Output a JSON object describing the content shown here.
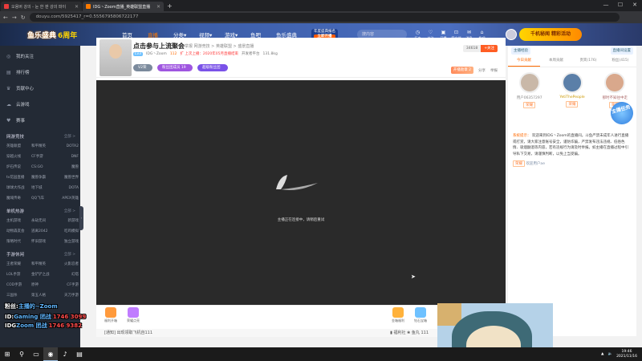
{
  "browser": {
    "tabs": [
      {
        "label": "오용버 강의 - 눈 한 판 강의 파이",
        "color": "#e83b3b",
        "active": false
      },
      {
        "label": "IDG丶Zoom直播_英雄联盟直播",
        "color": "#ff7a00",
        "active": true
      }
    ],
    "new_tab": "+",
    "url": "douyu.com/5925417_r=0.5556795806722177",
    "win_min": "—",
    "win_max": "☐",
    "win_close": "✕"
  },
  "nav": {
    "logo_text": "鱼乐盛典",
    "logo_year": "6周年",
    "links": [
      {
        "label": "首页",
        "active": false
      },
      {
        "label": "直播",
        "active": true
      },
      {
        "label": "分类▾",
        "active": false
      },
      {
        "label": "视频▾",
        "active": false
      },
      {
        "label": "游戏▾",
        "active": false
      },
      {
        "label": "鱼吧",
        "active": false
      },
      {
        "label": "鱼乐盛典",
        "active": false
      }
    ],
    "promo_top": "年度盛典报名",
    "promo_btn": "立即开播",
    "search_placeholder": "搜内容",
    "icons": [
      {
        "glyph": "◷",
        "label": "历史"
      },
      {
        "glyph": "♡",
        "label": "关注"
      },
      {
        "glyph": "▣",
        "label": "开播"
      },
      {
        "glyph": "⊡",
        "label": "客户端"
      },
      {
        "glyph": "✉",
        "label": "消息"
      },
      {
        "glyph": "⌂",
        "label": "鱼吧"
      }
    ],
    "banner_text": "千机秘闻 精彩活动"
  },
  "sidebar": {
    "main": [
      {
        "icon": "◎",
        "label": "我的关注"
      },
      {
        "icon": "▤",
        "label": "排行榜"
      },
      {
        "icon": "♛",
        "label": "贡献中心"
      },
      {
        "icon": "☁",
        "label": "云游戏"
      },
      {
        "icon": "♥",
        "label": "赛事"
      }
    ],
    "sections": [
      {
        "title": "网游竞技",
        "all": "全部 >",
        "items": [
          "英雄联盟",
          "和平精英",
          "DOTA2",
          "穿越火线",
          "CF手游",
          "DNF",
          "炉石传说",
          "CS:GO",
          "魔兽",
          "tv花园直播",
          "魔兽争霸",
          "魔兽世界",
          "球球大作战",
          "地下城",
          "DOTA",
          "魔域传奇",
          "QQ飞车",
          "APEX英雄"
        ]
      },
      {
        "title": "单机热游",
        "all": "全部 >",
        "items": [
          "主机游戏",
          "永劫无间",
          "新游戏",
          "动物森友会",
          "逃离2042",
          "吃鸡模拟",
          "策略时代",
          "怀旧游戏",
          "独立游戏"
        ]
      },
      {
        "title": "手游休闲",
        "all": "全部 >",
        "items": [
          "王者荣耀",
          "和平精英",
          "火影忍者",
          "LOL手游",
          "金铲铲之战",
          "幻塔",
          "COD手游",
          "原神",
          "CF手游",
          "三国杀",
          "第五人格",
          "天刀手游"
        ]
      }
    ],
    "collapse": "‹",
    "overlay": [
      {
        "prefix": "粉丝:",
        "name": "主播的~Zoom",
        "num": ""
      },
      {
        "prefix": "ID:",
        "name": "Gaming 团战",
        "num": "1746 3099"
      },
      {
        "prefix": "IDG",
        "name": "Zoom 团战",
        "num": "1746 9382"
      }
    ]
  },
  "room": {
    "title": "点击参与上流聚会",
    "crumbs": "举报  网游竞技 > 英雄联盟 > 盛景直播",
    "level": "Lv3",
    "name": "IDG丶Zoom",
    "hot": "112",
    "notice": "扩  上次上播：2020年05月直播结束",
    "location": "开发者平台",
    "fans": "131.8kg",
    "follow_count": "34618",
    "follow_label": "+关注",
    "pill1": "V2荣誉",
    "pill2": "粉丝团成员 19",
    "pill3": "超级粉丝团",
    "tag_label": "开播勋章 2",
    "share": "分享",
    "report": "举报",
    "loading_text": "主播正在连接中，请稍后重试",
    "gifts": [
      {
        "label": "福利开箱",
        "color": "#ff9a3c"
      },
      {
        "label": "荣耀点亮",
        "color": "#c07cff"
      },
      {
        "label": "金箱福利",
        "color": "#ffb23c"
      },
      {
        "label": "钻石宝箱",
        "color": "#6ec1ff"
      }
    ],
    "bottom_text": "[通知]  出现领取飞机自111",
    "bottom_right": "▮ 福利社  ❀ 鱼丸 111"
  },
  "chat": {
    "top_btn": "主播经验",
    "top_right": "直播间设置",
    "tabs": [
      {
        "label": "今日贡献",
        "active": true
      },
      {
        "label": "本周贡献",
        "active": false
      },
      {
        "label": "贵宾(176)",
        "active": false
      },
      {
        "label": "粉丝(415)",
        "active": false
      }
    ],
    "ranks": [
      {
        "name": "用户06357297",
        "badge": "荣耀",
        "color": "#888"
      },
      {
        "name": "YetiThePeople",
        "badge": "荣耀",
        "color": "#c90"
      },
      {
        "name": "那时不知往中走",
        "badge": "荣耀",
        "color": "#a66"
      }
    ],
    "task_badge": "主播任务",
    "sys_label": "系统提示：",
    "sys_msg": "欢迎来到IDG丶Zoom的直播间。斗鱼严禁未成年人进行直播或打赏，请大家注意账号安全，谨防诈骗，严禁发布违法违规、低俗色情、吸烟酗酒等内容，若有违规行为请及时举报。如主播在直播过程中引导私下交易，请谨慎判断，以免上当受骗。",
    "chat_line": "欢迎用户ae",
    "chat_tag": "荣耀"
  },
  "taskbar": {
    "items": [
      {
        "glyph": "⊞",
        "active": false
      },
      {
        "glyph": "⚲",
        "active": false
      },
      {
        "glyph": "▭",
        "active": false
      },
      {
        "glyph": "◉",
        "active": true
      },
      {
        "glyph": "♪",
        "active": false
      },
      {
        "glyph": "▤",
        "active": false
      }
    ],
    "time": "19:46",
    "date": "2021/11/16"
  }
}
